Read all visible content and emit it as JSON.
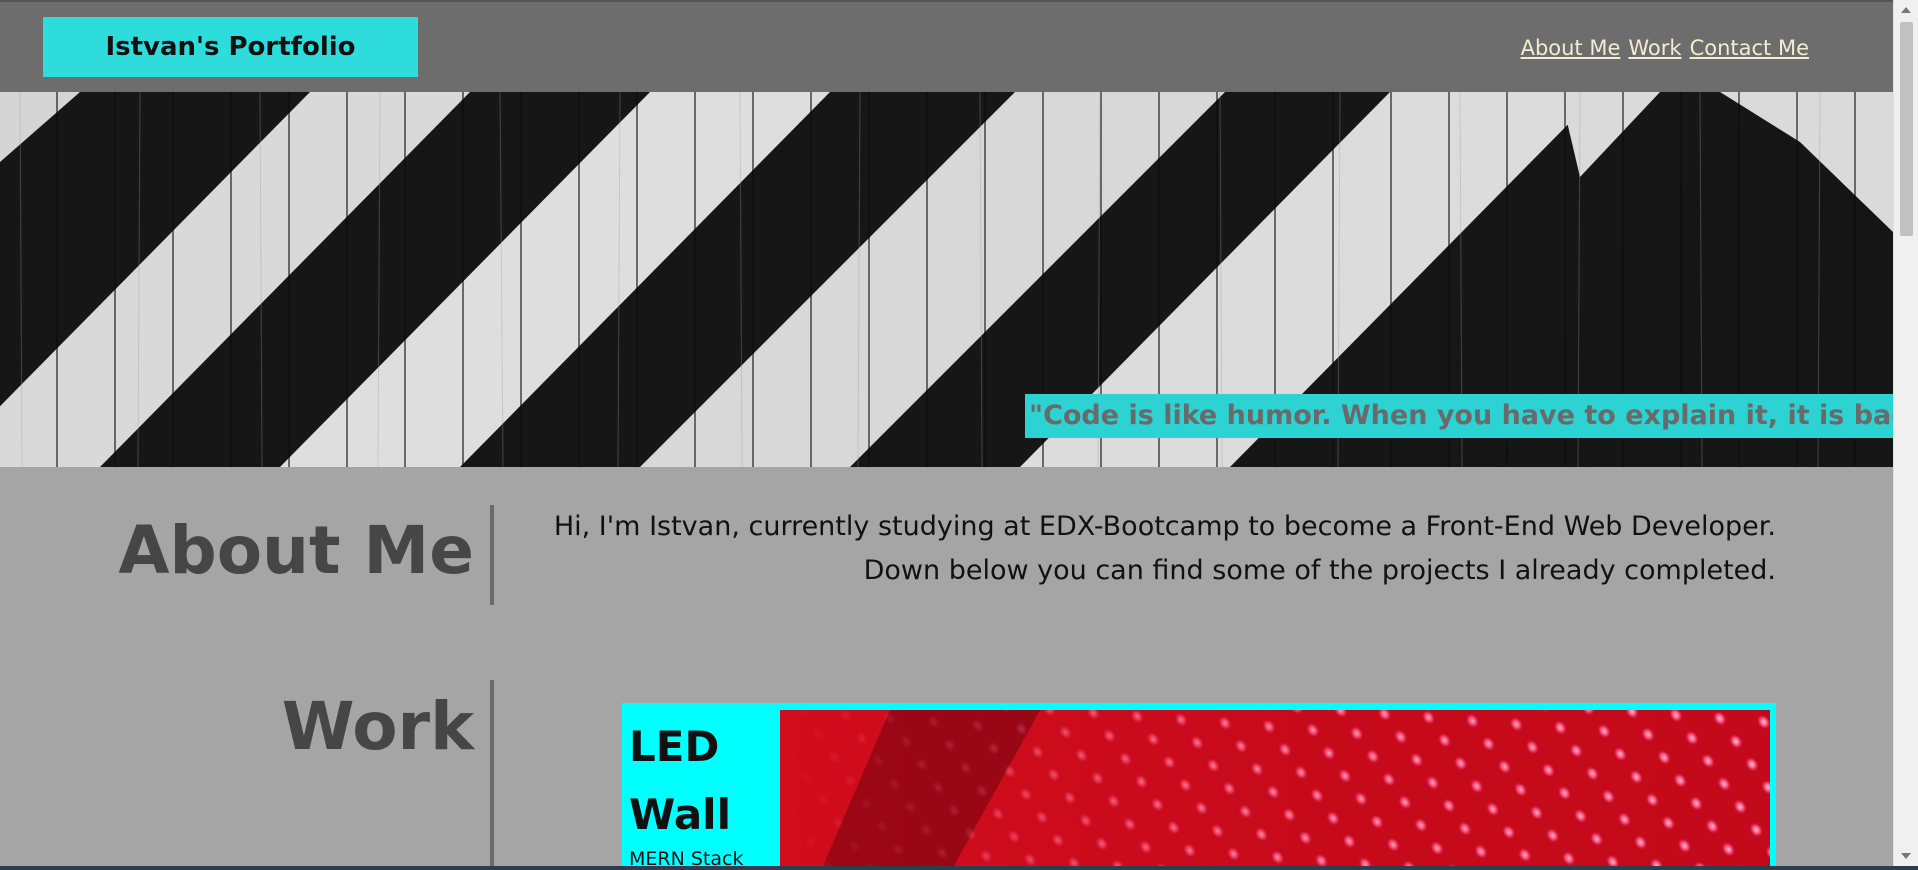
{
  "header": {
    "brand": "Istvan's Portfolio",
    "nav": [
      {
        "label": "About Me"
      },
      {
        "label": "Work"
      },
      {
        "label": "Contact Me"
      }
    ]
  },
  "hero": {
    "quote": "\"Code is like humor. When you have to explain it, it is bad.\""
  },
  "about": {
    "title": "About Me",
    "line1": "Hi, I'm Istvan, currently studying at EDX-Bootcamp to become a Front-End Web Developer.",
    "line2": "Down below you can find some of the projects I already completed."
  },
  "work": {
    "title": "Work",
    "projects": [
      {
        "title_line1": "LED",
        "title_line2": "Wall",
        "subtitle": "MERN Stack"
      }
    ]
  },
  "colors": {
    "accent": "#2edcdc",
    "header_bg": "#6d6d6d",
    "page_bg": "#a5a5a5",
    "nav_link": "#f4ecd0",
    "card_bg": "#00ffff"
  }
}
